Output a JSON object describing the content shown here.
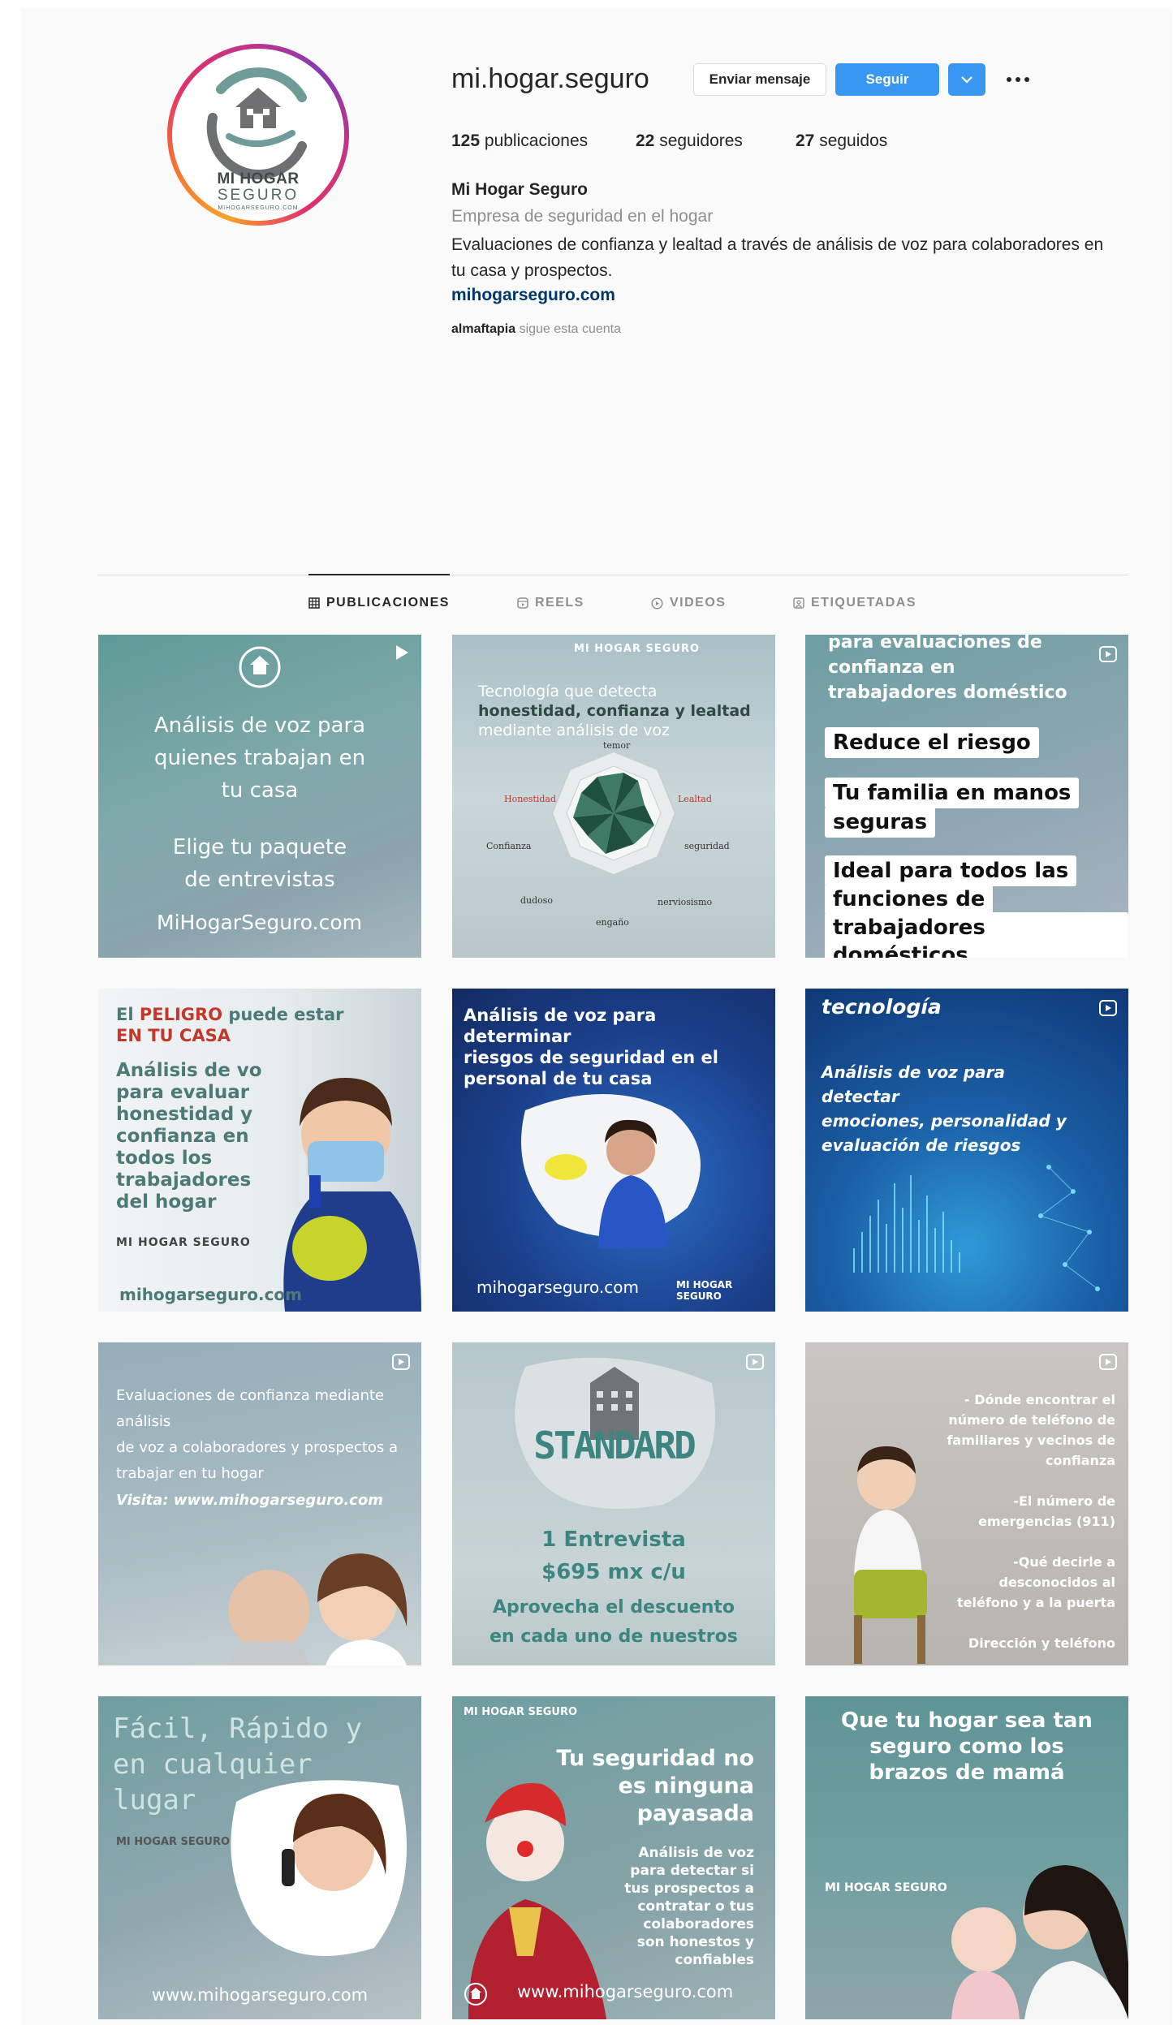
{
  "profile": {
    "username": "mi.hogar.seguro",
    "message_button": "Enviar mensaje",
    "follow_button": "Seguir",
    "dropdown_icon": "chevron-down-icon",
    "more_icon": "ellipsis-icon",
    "stats": {
      "posts_count": "125",
      "posts_label": "publicaciones",
      "followers_count": "22",
      "followers_label": "seguidores",
      "following_count": "27",
      "following_label": "seguidos"
    },
    "display_name": "Mi Hogar Seguro",
    "category": "Empresa de seguridad en el hogar",
    "bio": "Evaluaciones de confianza y lealtad a través de análisis de voz para colaboradores en tu casa y prospectos.",
    "website": "mihogarseguro.com",
    "followed_by_user": "almaftapia",
    "followed_by_text": "sigue esta cuenta",
    "avatar_logo": {
      "line1": "MI HOGAR",
      "line2": "SEGURO",
      "line3": "MIHOGARSEGURO.COM"
    }
  },
  "tabs": [
    {
      "label": "PUBLICACIONES",
      "icon": "grid-icon",
      "active": true
    },
    {
      "label": "REELS",
      "icon": "reels-icon",
      "active": false
    },
    {
      "label": "VIDEOS",
      "icon": "play-icon",
      "active": false
    },
    {
      "label": "ETIQUETADAS",
      "icon": "tagged-icon",
      "active": false
    }
  ],
  "posts": {
    "p1": {
      "type": "video",
      "lines": [
        "Análisis de voz para",
        "quienes trabajan en",
        "tu casa",
        "Elige tu paquete",
        "de entrevistas",
        "MiHogarSeguro.com"
      ]
    },
    "p2": {
      "type": "image",
      "logo": "MI HOGAR SEGURO",
      "title1": "Tecnología que detecta",
      "title2": "honestidad, confianza y lealtad",
      "title3": "mediante análisis de voz",
      "radar_labels": [
        "temor",
        "Lealtad",
        "seguridad",
        "nerviosismo",
        "engaño",
        "dudoso",
        "Confianza",
        "Honestidad"
      ]
    },
    "p3": {
      "type": "reel",
      "top": "para evaluaciones de confianza en trabajadores doméstico",
      "boxes": [
        "Reduce el riesgo",
        "Tu familia en manos",
        "seguras",
        "Ideal para todos las",
        "funciones de",
        "trabajadores domésticos"
      ]
    },
    "p4": {
      "type": "image",
      "head1": "El ",
      "head1b": "PELIGRO",
      "head1c": " puede estar",
      "head2": "EN TU CASA",
      "body": [
        "Análisis de vo",
        "para evaluar",
        "honestidad y",
        "confianza en",
        "todos los",
        "trabajadores",
        "del hogar"
      ],
      "footer": "mihogarseguro.com",
      "logo": "MI HOGAR SEGURO"
    },
    "p5": {
      "type": "image",
      "title": [
        "Análisis de voz para determinar",
        "riesgos de seguridad en el",
        "personal de tu casa"
      ],
      "footer": "mihogarseguro.com",
      "logo": "MI HOGAR SEGURO"
    },
    "p6": {
      "type": "reel",
      "top": "tecnología",
      "body": [
        "Análisis de voz para detectar",
        "emociones, personalidad y",
        "evaluación de riesgos"
      ]
    },
    "p7": {
      "type": "reel",
      "body": [
        "Evaluaciones de confianza mediante análisis",
        "de voz a colaboradores y prospectos a",
        "trabajar en tu hogar"
      ],
      "visit": "Visita: www.mihogarseguro.com"
    },
    "p8": {
      "type": "reel",
      "badge": "STANDARD",
      "line1": "1 Entrevista",
      "line2": "$695 mx c/u",
      "line3": "Aprovecha el descuento",
      "line4": "en cada uno de nuestros"
    },
    "p9": {
      "type": "reel",
      "items": [
        "- Dónde encontrar el",
        "número de teléfono de",
        "familiares y vecinos de",
        "confianza",
        "",
        "-El número de",
        "emergencias (911)",
        "",
        "-Qué decirle a",
        "desconocidos al",
        "teléfono y a la puerta",
        "",
        "Dirección y teléfono"
      ]
    },
    "p10": {
      "type": "image",
      "title": [
        "Fácil, Rápido y",
        "en cualquier",
        "lugar"
      ],
      "footer": "www.mihogarseguro.com",
      "logo": "MI HOGAR SEGURO"
    },
    "p11": {
      "type": "image",
      "logo": "MI HOGAR SEGURO",
      "title": [
        "Tu seguridad no",
        "es ninguna",
        "payasada"
      ],
      "body": [
        "Análisis de voz",
        "para detectar si",
        "tus prospectos a",
        "contratar o tus",
        "colaboradores",
        "son honestos y",
        "confiables"
      ],
      "footer": "www.mihogarseguro.com"
    },
    "p12": {
      "type": "image",
      "title": [
        "Que tu hogar sea tan",
        "seguro como los",
        "brazos de mamá"
      ],
      "logo": "MI HOGAR SEGURO"
    }
  }
}
